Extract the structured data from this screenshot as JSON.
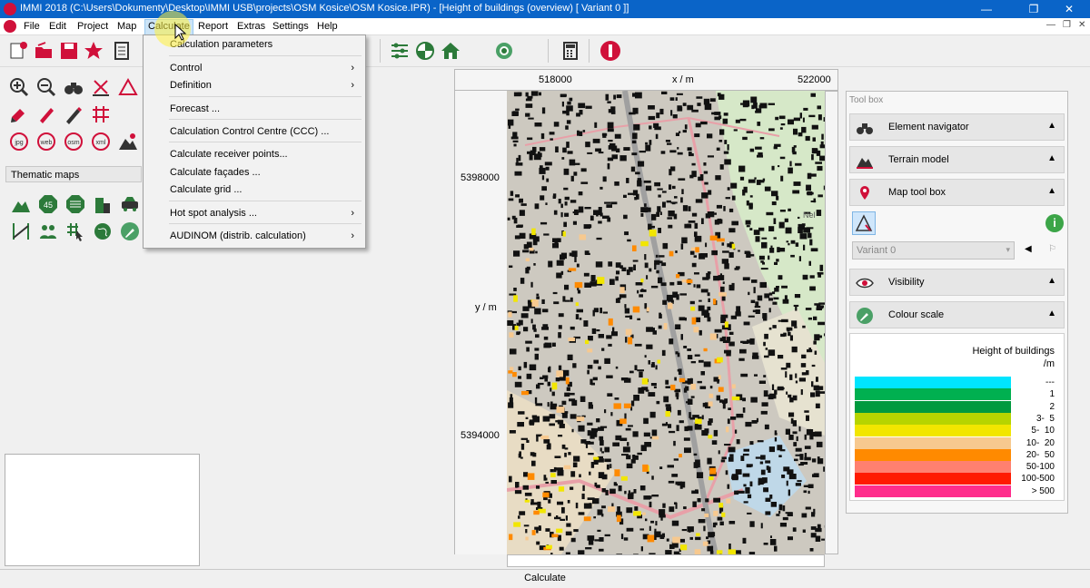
{
  "window": {
    "title": "IMMI 2018 (C:\\Users\\Dokumenty\\Desktop\\IMMI USB\\projects\\OSM Kosice\\OSM Kosice.IPR) - [Height of buildings (overview)   [ Variant 0 ]]",
    "minimize": "—",
    "maximize": "❐",
    "close": "✕",
    "colors": {
      "titlebar": "#0a64c8",
      "brand": "#d0103a"
    }
  },
  "menubar": {
    "items": [
      "File",
      "Edit",
      "Project",
      "Map",
      "Calculate",
      "Report",
      "Extras",
      "Settings",
      "Help"
    ],
    "active": "Calculate",
    "mdi": {
      "minimize": "—",
      "restore": "❐",
      "close": "✕"
    }
  },
  "dropdown": {
    "items": [
      {
        "label": "Calculation parameters",
        "submenu": false
      },
      {
        "label": "Control",
        "submenu": true
      },
      {
        "label": "Definition",
        "submenu": true
      },
      {
        "label": "Forecast ...",
        "submenu": false
      },
      {
        "label": "Calculation Control Centre (CCC) ...",
        "submenu": false
      },
      {
        "label": "Calculate receiver points...",
        "submenu": false
      },
      {
        "label": "Calculate façades ...",
        "submenu": false
      },
      {
        "label": "Calculate grid ...",
        "submenu": false
      },
      {
        "label": "Hot spot analysis ...",
        "submenu": true
      },
      {
        "label": "AUDINOM (distrib. calculation)",
        "submenu": true
      }
    ]
  },
  "leftpanel": {
    "thematic_label": "Thematic maps",
    "import_icons": [
      "jpg",
      "web",
      "osm",
      "xml"
    ],
    "badge": "45"
  },
  "map": {
    "x_tick_left": "518000",
    "x_label": "x / m",
    "x_tick_right": "522000",
    "y_tick_top": "5398000",
    "y_label": "y / m",
    "y_tick_bottom": "5394000",
    "place_label": "Nel"
  },
  "toolbox": {
    "title": "Tool box",
    "sections": {
      "element_navigator": "Element navigator",
      "terrain_model": "Terrain model",
      "map_tool_box": "Map tool box",
      "visibility": "Visibility",
      "colour_scale": "Colour scale"
    },
    "variant_select": "Variant 0",
    "info": "i",
    "colour_scale": {
      "title": "Height of buildings",
      "unit": "/m",
      "entries": [
        {
          "label": "---",
          "color": "#00e5ff"
        },
        {
          "label": "1",
          "color": "#00b050"
        },
        {
          "label": "2",
          "color": "#009a3e"
        },
        {
          "label": "3-  5",
          "color": "#b6d400"
        },
        {
          "label": "5-  10",
          "color": "#f2e600"
        },
        {
          "label": "10-  20",
          "color": "#f7c98f"
        },
        {
          "label": "20-  50",
          "color": "#ff8a00"
        },
        {
          "label": "50-100",
          "color": "#ff8070"
        },
        {
          "label": "100-500",
          "color": "#ff1a00"
        },
        {
          "label": "> 500",
          "color": "#ff2d8c"
        }
      ]
    }
  },
  "statusbar": {
    "text": "Calculate"
  }
}
